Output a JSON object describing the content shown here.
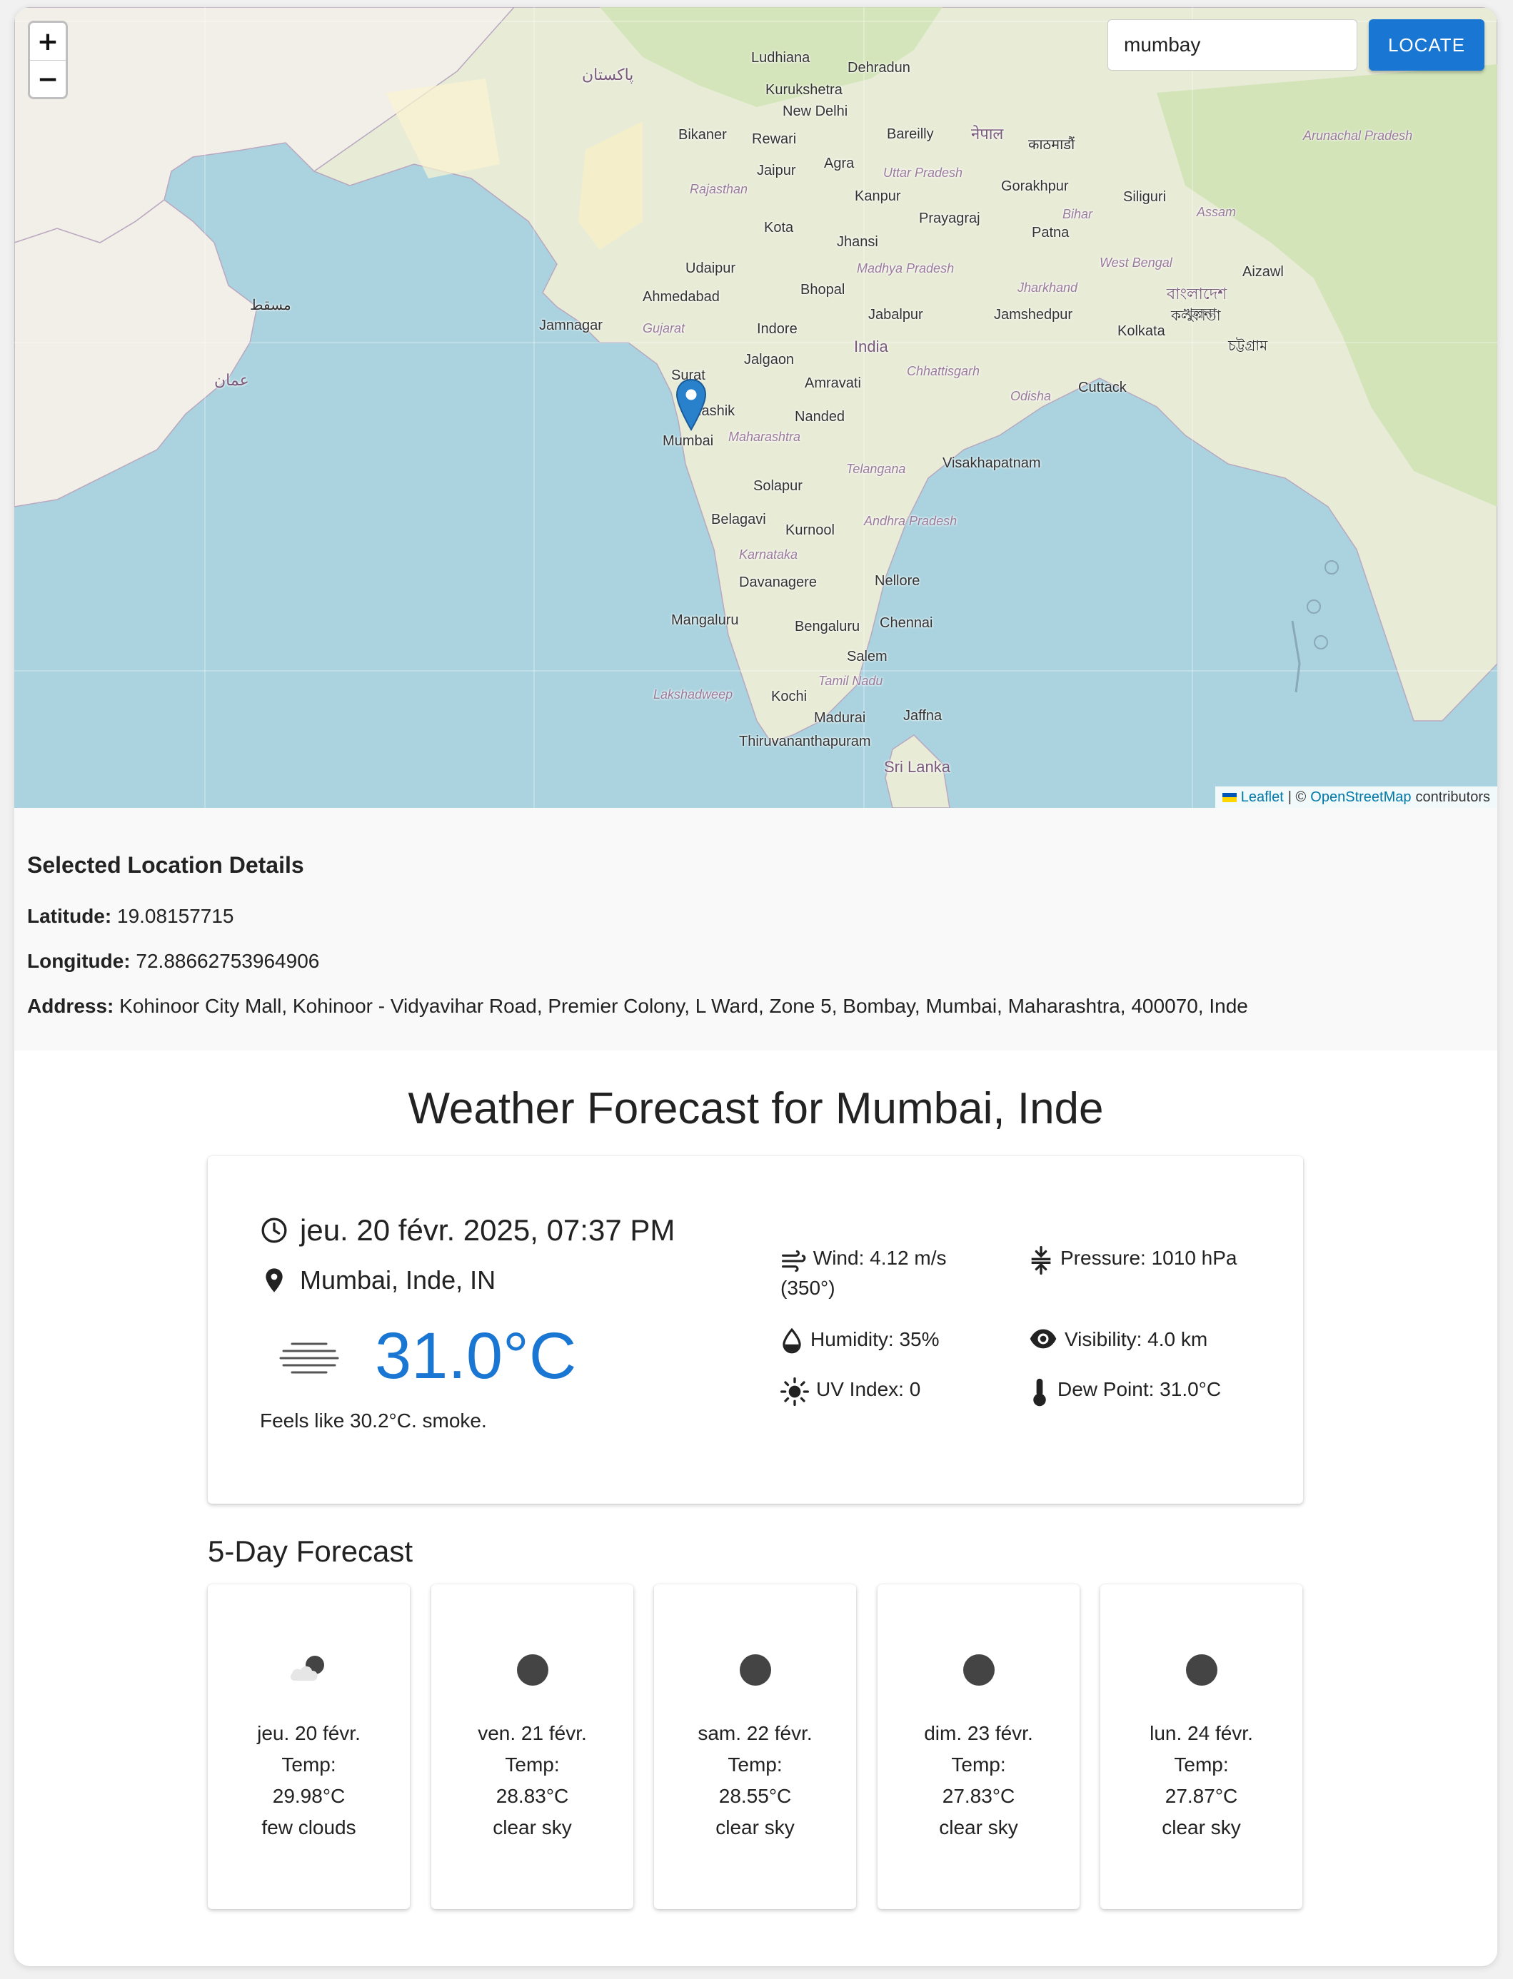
{
  "map": {
    "zoom_in": "+",
    "zoom_out": "−",
    "search": {
      "value": "mumbay",
      "placeholder": ""
    },
    "locate_label": "LOCATE",
    "labels": [
      {
        "t": "Ludhiana"
      },
      {
        "t": "Dehradun"
      },
      {
        "t": "Kurukshetra"
      },
      {
        "t": "New Delhi"
      },
      {
        "t": "Bikaner"
      },
      {
        "t": "Rewari"
      },
      {
        "t": "Bareilly"
      },
      {
        "t": "नेपाल"
      },
      {
        "t": "काठमाडौं"
      },
      {
        "t": "Jaipur"
      },
      {
        "t": "Agra"
      },
      {
        "t": "Uttar Pradesh"
      },
      {
        "t": "Rajasthan"
      },
      {
        "t": "Kanpur"
      },
      {
        "t": "Gorakhpur"
      },
      {
        "t": "Prayagraj"
      },
      {
        "t": "Siliguri"
      },
      {
        "t": "Kota"
      },
      {
        "t": "Jhansi"
      },
      {
        "t": "Patna"
      },
      {
        "t": "Bihar"
      },
      {
        "t": "Udaipur"
      },
      {
        "t": "Madhya Pradesh"
      },
      {
        "t": "Jharkhand"
      },
      {
        "t": "West Bengal"
      },
      {
        "t": "Ahmedabad"
      },
      {
        "t": "Bhopal"
      },
      {
        "t": "Jabalpur"
      },
      {
        "t": "Jamshedpur"
      },
      {
        "t": "Kolkata"
      },
      {
        "t": "Jamnagar"
      },
      {
        "t": "Gujarat"
      },
      {
        "t": "Indore"
      },
      {
        "t": "India"
      },
      {
        "t": "Jalgaon"
      },
      {
        "t": "Chhattisgarh"
      },
      {
        "t": "Surat"
      },
      {
        "t": "Amravati"
      },
      {
        "t": "Nashik"
      },
      {
        "t": "Odisha"
      },
      {
        "t": "Cuttack"
      },
      {
        "t": "Nanded"
      },
      {
        "t": "Mumbai"
      },
      {
        "t": "Maharashtra"
      },
      {
        "t": "Telangana"
      },
      {
        "t": "Visakhapatnam"
      },
      {
        "t": "Solapur"
      },
      {
        "t": "Belagavi"
      },
      {
        "t": "Kurnool"
      },
      {
        "t": "Andhra Pradesh"
      },
      {
        "t": "Karnataka"
      },
      {
        "t": "Davanagere"
      },
      {
        "t": "Nellore"
      },
      {
        "t": "Mangaluru"
      },
      {
        "t": "Bengaluru"
      },
      {
        "t": "Chennai"
      },
      {
        "t": "Salem"
      },
      {
        "t": "Tamil Nadu"
      },
      {
        "t": "Lakshadweep"
      },
      {
        "t": "Kochi"
      },
      {
        "t": "Madurai"
      },
      {
        "t": "Jaffna"
      },
      {
        "t": "Thiruvananthapuram"
      },
      {
        "t": "Sri Lanka"
      },
      {
        "t": "Arunachal Pradesh"
      },
      {
        "t": "Assam"
      },
      {
        "t": "Aizawl"
      },
      {
        "t": "কলকাতা"
      },
      {
        "t": "বাংলাদেশ"
      },
      {
        "t": "খুলনা"
      },
      {
        "t": "চট্টগ্রাম"
      },
      {
        "t": "پاکستان"
      },
      {
        "t": "عمان"
      },
      {
        "t": "مسقط"
      }
    ],
    "attribution": {
      "leaflet": "Leaflet",
      "sep": "| ©",
      "osm": "OpenStreetMap",
      "tail": "contributors"
    }
  },
  "details": {
    "heading": "Selected Location Details",
    "latitude_label": "Latitude:",
    "latitude": "19.08157715",
    "longitude_label": "Longitude:",
    "longitude": "72.88662753964906",
    "address_label": "Address:",
    "address": "Kohinoor City Mall, Kohinoor - Vidyavihar Road, Premier Colony, L Ward, Zone 5, Bombay, Mumbai, Maharashtra, 400070, Inde"
  },
  "weather": {
    "title": "Weather Forecast for Mumbai, Inde",
    "datetime": "jeu. 20 févr. 2025, 07:37 PM",
    "location": "Mumbai, Inde, IN",
    "temperature": "31.0°C",
    "feels": "Feels like 30.2°C. smoke.",
    "wind_line1": "Wind: 4.12 m/s",
    "wind_line2": "(350°)",
    "pressure": "Pressure: 1010 hPa",
    "humidity": "Humidity: 35%",
    "visibility": "Visibility: 4.0 km",
    "uv": "UV Index: 0",
    "dew": "Dew Point: 31.0°C",
    "accent_color": "#1976d2",
    "icons": [
      "clock-icon",
      "location-pin-icon",
      "haze-icon",
      "wind-icon",
      "pressure-icon",
      "humidity-drop-icon",
      "eye-icon",
      "sun-icon",
      "thermometer-icon"
    ]
  },
  "forecast": {
    "title": "5-Day Forecast",
    "days": [
      {
        "date": "jeu. 20 févr.",
        "temp_label": "Temp:",
        "temp": "29.98°C",
        "desc": "few clouds",
        "icon": "few-clouds-night-icon"
      },
      {
        "date": "ven. 21 févr.",
        "temp_label": "Temp:",
        "temp": "28.83°C",
        "desc": "clear sky",
        "icon": "clear-night-icon"
      },
      {
        "date": "sam. 22 févr.",
        "temp_label": "Temp:",
        "temp": "28.55°C",
        "desc": "clear sky",
        "icon": "clear-night-icon"
      },
      {
        "date": "dim. 23 févr.",
        "temp_label": "Temp:",
        "temp": "27.83°C",
        "desc": "clear sky",
        "icon": "clear-night-icon"
      },
      {
        "date": "lun. 24 févr.",
        "temp_label": "Temp:",
        "temp": "27.87°C",
        "desc": "clear sky",
        "icon": "clear-night-icon"
      }
    ]
  }
}
